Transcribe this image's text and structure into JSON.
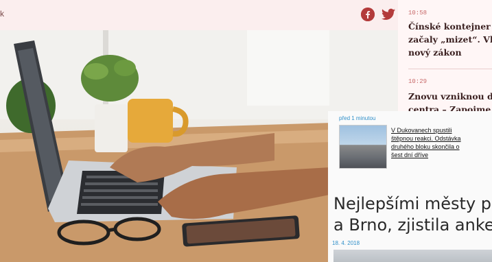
{
  "header": {
    "crumb": "k",
    "share_icons": [
      "facebook-icon",
      "twitter-icon"
    ],
    "facebook_color": "#b33b3b",
    "twitter_color": "#b33b3b"
  },
  "news": [
    {
      "time": "10:58",
      "lines": [
        "Čínské kontejner",
        "začaly „mizet“. Vl",
        "nový zákon"
      ]
    },
    {
      "time": "10:29",
      "lines": [
        "Znovu vzniknou d",
        "centra – Zapoime"
      ]
    }
  ],
  "clipping": {
    "ago": "před 1 minutou",
    "cite_lines": [
      "V Dukovanech spustili",
      "štěpnou reakci. Odstávka",
      "druhého bloku skončila o",
      "šest dní dříve"
    ],
    "title_lines": [
      "Nejlepšími městy pr",
      "a Brno, zjistila anket"
    ],
    "date": "18. 4. 2018"
  }
}
